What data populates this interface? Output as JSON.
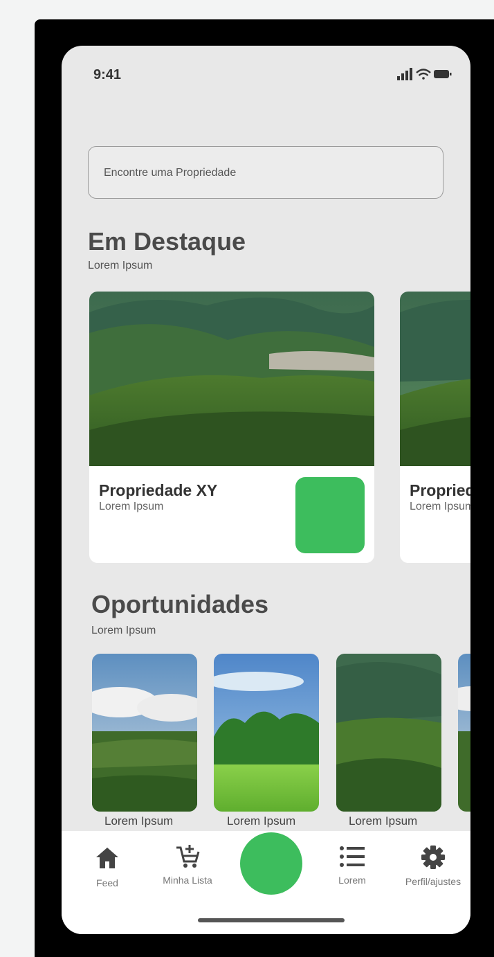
{
  "status_bar": {
    "time": "9:41",
    "icons": [
      "signal-icon",
      "wifi-icon",
      "battery-icon"
    ]
  },
  "search": {
    "placeholder": "Encontre uma Propriedade"
  },
  "featured": {
    "title": "Em Destaque",
    "subtitle": "Lorem Ipsum",
    "cards": [
      {
        "title": "Propriedade XY",
        "subtitle": "Lorem Ipsum"
      },
      {
        "title": "Propriedade XY",
        "subtitle": "Lorem Ipsum"
      }
    ]
  },
  "opportunities": {
    "title": "Oportunidades",
    "subtitle": "Lorem Ipsum",
    "items": [
      {
        "label": "Lorem Ipsum"
      },
      {
        "label": "Lorem Ipsum"
      },
      {
        "label": "Lorem Ipsum"
      },
      {
        "label": ""
      }
    ]
  },
  "tabbar": {
    "items": [
      {
        "label": "Feed",
        "icon": "home-icon"
      },
      {
        "label": "Minha Lista",
        "icon": "cart-add-icon"
      },
      {
        "label": "Lorem",
        "icon": "list-icon"
      },
      {
        "label": "Perfil/ajustes",
        "icon": "gear-icon"
      }
    ]
  },
  "colors": {
    "accent": "#3dbd5d",
    "frame": "#000000",
    "screen": "#e8e8e8"
  }
}
